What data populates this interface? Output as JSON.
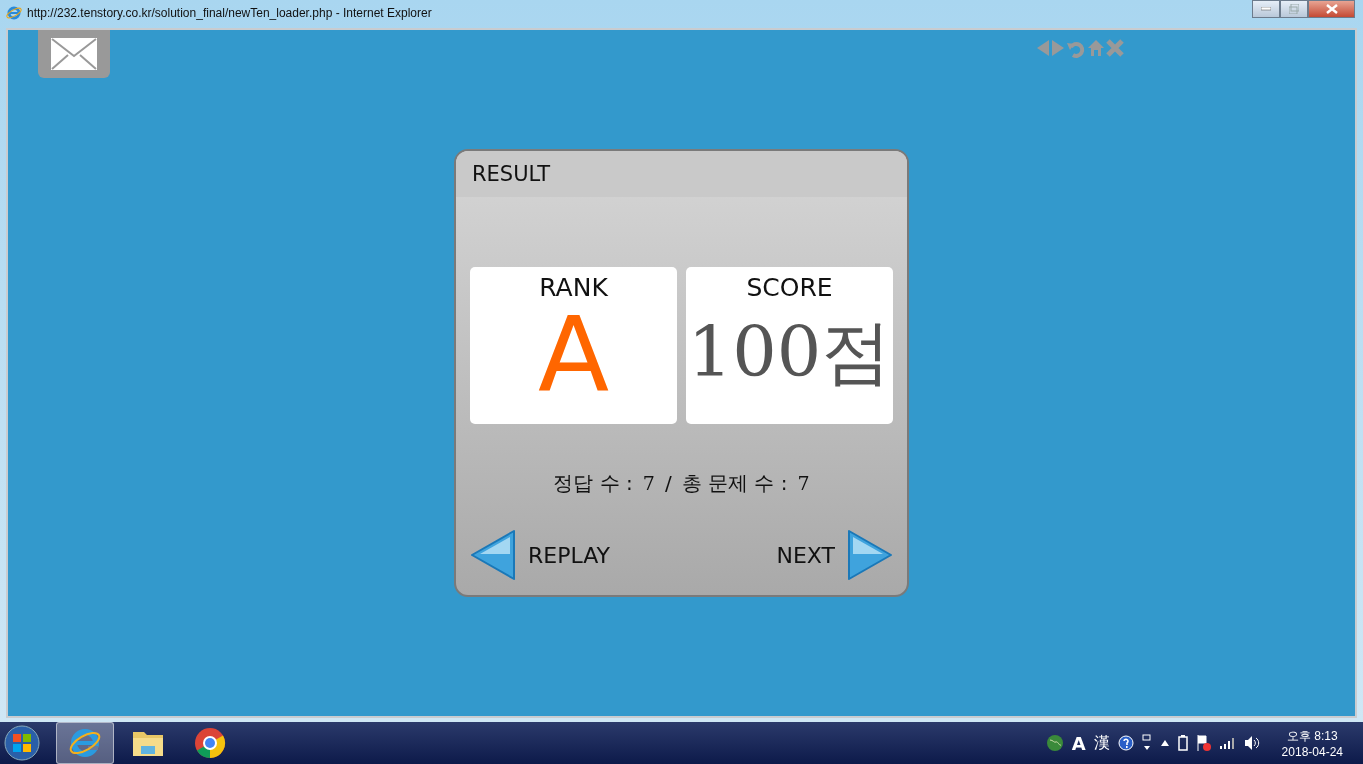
{
  "window": {
    "title": "http://232.tenstory.co.kr/solution_final/newTen_loader.php - Internet Explorer"
  },
  "result": {
    "title": "RESULT",
    "rank": {
      "label": "RANK",
      "value": "A"
    },
    "score": {
      "label": "SCORE",
      "value": "100점"
    },
    "summary": {
      "correct_label": "정답 수 :",
      "correct_value": "7",
      "separator": "/",
      "total_label": "총 문제 수 :",
      "total_value": "7"
    },
    "replay": "REPLAY",
    "next": "NEXT"
  },
  "taskbar": {
    "apps": [
      {
        "kind": "ie",
        "selected": true
      },
      {
        "kind": "folder",
        "selected": false
      },
      {
        "kind": "chrome",
        "selected": false
      }
    ],
    "ime_mode": "A",
    "ime_hanja": "漢",
    "clock_time": "오후 8:13",
    "clock_date": "2018-04-24"
  }
}
